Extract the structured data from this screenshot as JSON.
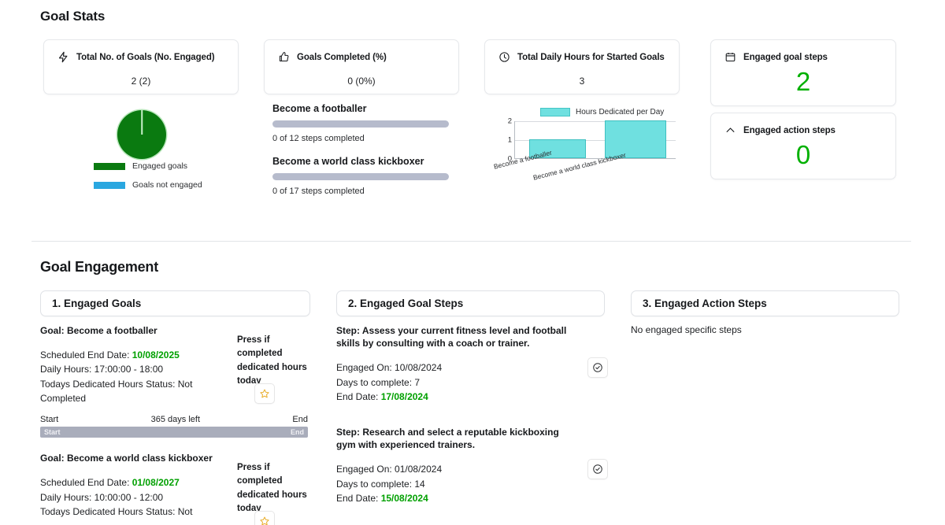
{
  "sections": {
    "goal_stats_title": "Goal Stats",
    "goal_engagement_title": "Goal Engagement"
  },
  "stat_cards": [
    {
      "icon": "lightning-icon",
      "label": "Total No. of Goals (No. Engaged)",
      "value": "2 (2)"
    },
    {
      "icon": "thumbs-up-icon",
      "label": "Goals Completed (%)",
      "value": "0 (0%)"
    },
    {
      "icon": "clock-icon",
      "label": "Total Daily Hours for Started Goals",
      "value": "3"
    },
    {
      "icon": "calendar-icon",
      "label": "Engaged goal steps",
      "value": "2"
    },
    {
      "icon": "chevron-up-icon",
      "label": "Engaged action steps",
      "value": "0"
    }
  ],
  "colors": {
    "engaged_green": "#0a7a10",
    "not_engaged_blue": "#2aa7e0",
    "value_green": "#00b000",
    "date_green": "#00a000",
    "bar_cyan": "#6fe0e0",
    "progress_gray": "#b6bbcc"
  },
  "chart_data": [
    {
      "type": "pie",
      "title": "",
      "labels": [
        "Engaged goals",
        "Goals not engaged"
      ],
      "values": [
        2,
        0
      ],
      "colors": [
        "#0a7a10",
        "#2aa7e0"
      ],
      "legend_position": "bottom-left"
    },
    {
      "type": "bar",
      "title": "",
      "legend": [
        "Hours Dedicated per Day"
      ],
      "categories": [
        "Become a footballer",
        "Become a world class kickboxer"
      ],
      "values": [
        1,
        2
      ],
      "ylabel": "",
      "xlabel": "",
      "yticks": [
        0,
        1,
        2
      ],
      "ylim": [
        0,
        2
      ],
      "grid": true,
      "color": "#6fe0e0",
      "legend_position": "top"
    }
  ],
  "goal_progress": [
    {
      "title": "Become a footballer",
      "steps_text": "0 of 12 steps completed",
      "completed": 0,
      "total": 12
    },
    {
      "title": "Become a world class kickboxer",
      "steps_text": "0 of 17 steps completed",
      "completed": 0,
      "total": 17
    }
  ],
  "engagement": {
    "col1": {
      "header": "1. Engaged Goals",
      "press_note": "Press if completed dedicated hours today",
      "star_icon": "star-icon",
      "goals": [
        {
          "title": "Goal: Become a footballer",
          "end_date_label": "Scheduled End Date: ",
          "end_date": "10/08/2025",
          "daily_hours": "Daily Hours: 17:00:00 - 18:00",
          "status": "Todays Dedicated Hours Status: Not Completed",
          "timeline_start": "Start",
          "timeline_middle": "365 days left",
          "timeline_end": "End",
          "bar_start_label": "Start",
          "bar_end_label": "End"
        },
        {
          "title": "Goal: Become a world class kickboxer",
          "end_date_label": "Scheduled End Date: ",
          "end_date": "01/08/2027",
          "daily_hours": "Daily Hours: 10:00:00 - 12:00",
          "status": "Todays Dedicated Hours Status: Not",
          "timeline_start": "",
          "timeline_middle": "",
          "timeline_end": "",
          "bar_start_label": "",
          "bar_end_label": ""
        }
      ]
    },
    "col2": {
      "header": "2. Engaged Goal Steps",
      "check_icon": "check-circle-icon",
      "steps": [
        {
          "title": "Step: Assess your current fitness level and football skills by consulting with a coach or trainer.",
          "engaged_on": "Engaged On: 10/08/2024",
          "days_to_complete": "Days to complete: 7",
          "end_date_label": "End Date: ",
          "end_date": "17/08/2024"
        },
        {
          "title": "Step: Research and select a reputable kickboxing gym with experienced trainers.",
          "engaged_on": "Engaged On: 01/08/2024",
          "days_to_complete": "Days to complete: 14",
          "end_date_label": "End Date: ",
          "end_date": "15/08/2024"
        }
      ]
    },
    "col3": {
      "header": "3. Engaged Action Steps",
      "empty_message": "No engaged specific steps"
    }
  }
}
